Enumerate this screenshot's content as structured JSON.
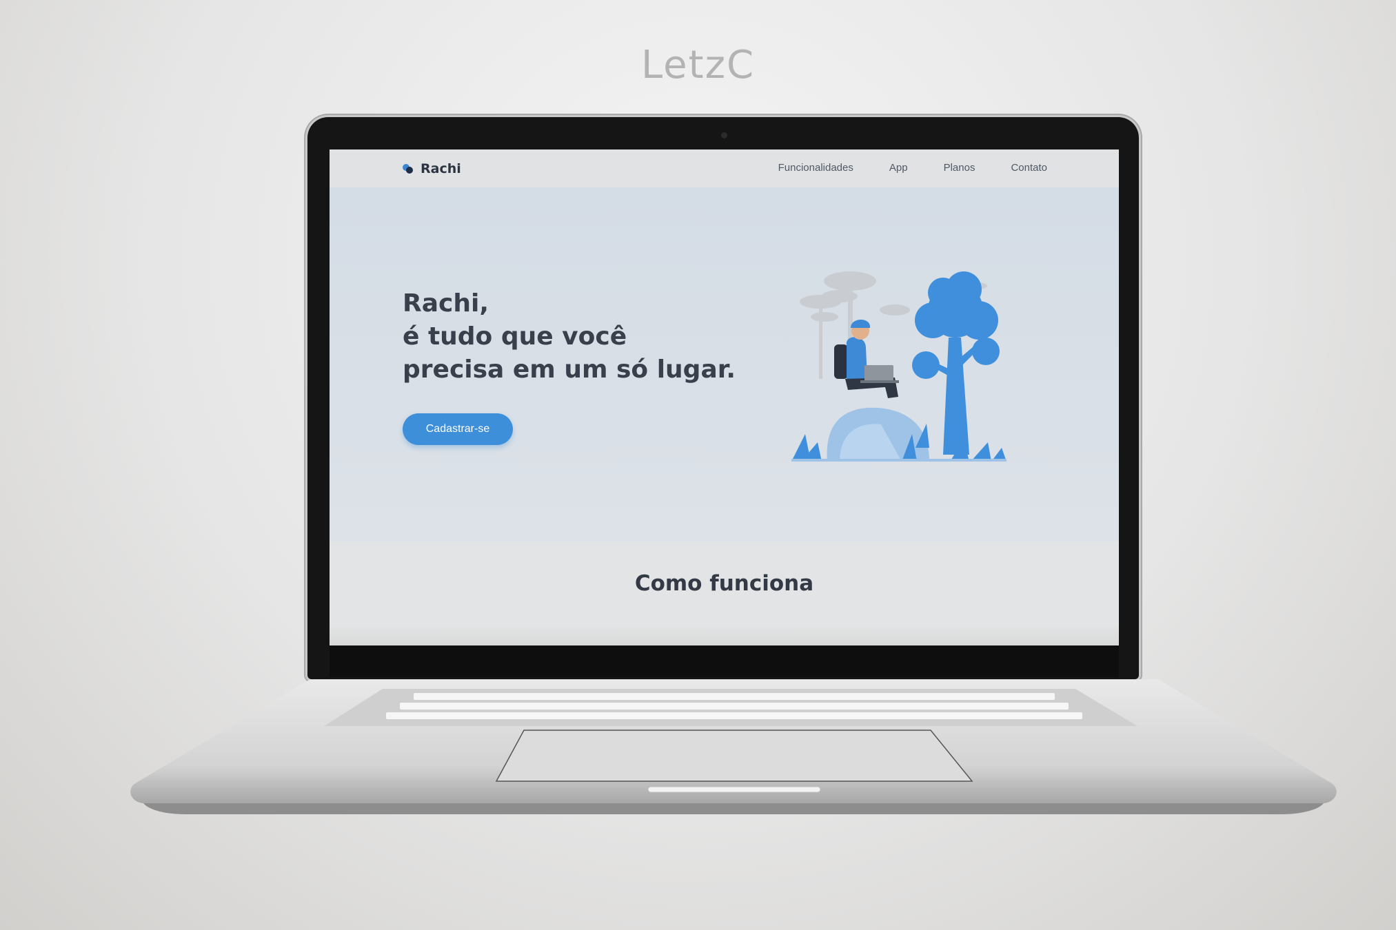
{
  "watermark": "LetzC",
  "site": {
    "brand": "Rachi",
    "nav": [
      "Funcionalidades",
      "App",
      "Planos",
      "Contato"
    ],
    "hero": {
      "headline_lines": [
        "Rachi,",
        "é tudo que você",
        "precisa em um só lugar."
      ],
      "cta_label": "Cadastrar-se"
    },
    "section_title": "Como funciona"
  },
  "colors": {
    "accent": "#3d8fda",
    "brand_dark": "#1f2d46",
    "hero_bg": "#d8dfe6",
    "text_dark": "#3a404b"
  },
  "icons": {
    "logo": "two-dots-logo-icon",
    "illustration": "person-with-laptop-under-trees"
  }
}
